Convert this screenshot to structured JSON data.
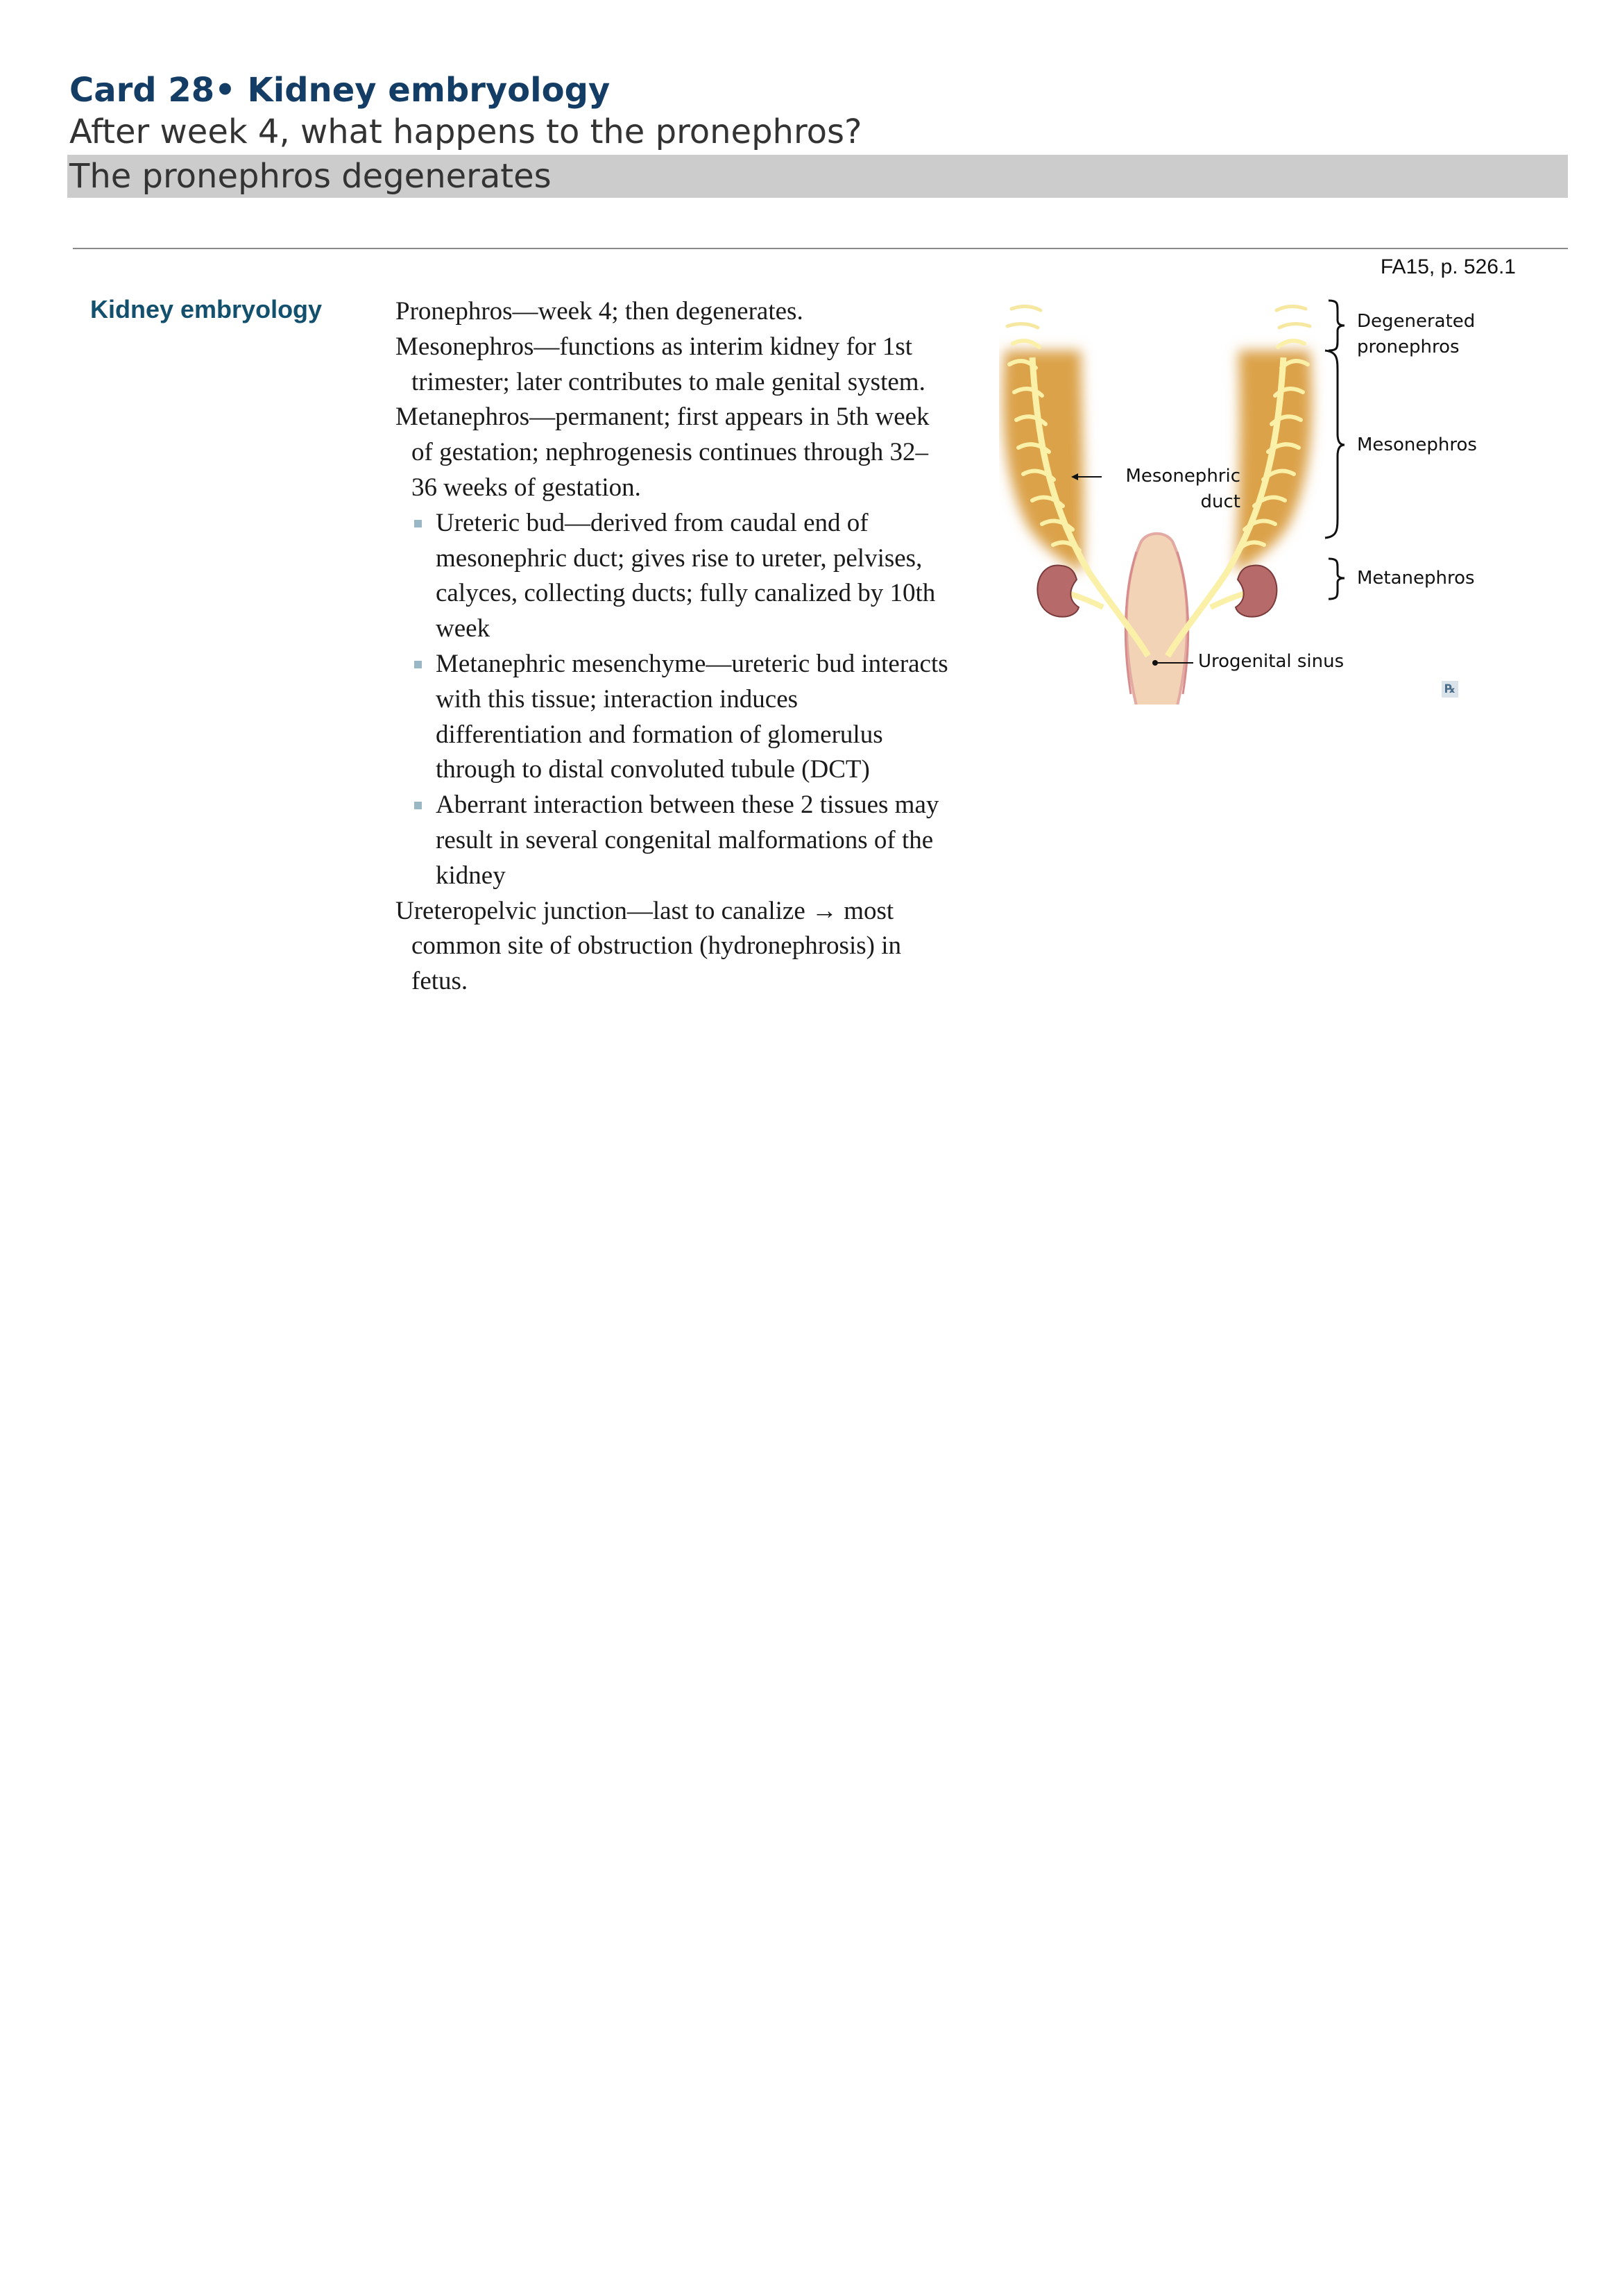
{
  "card": {
    "title": "Card 28• Kidney embryology",
    "question": "After week 4, what happens to the pronephros?",
    "answer": "The pronephros degenerates"
  },
  "source_ref": "FA15, p. 526.1",
  "section": {
    "heading": "Kidney embryology",
    "paragraphs": [
      "Pronephros—week 4; then degenerates.",
      "Mesonephros—functions as interim kidney for 1st trimester; later contributes to male genital system.",
      "Metanephros—permanent; first appears in 5th week of gestation; nephrogenesis continues through 32–36 weeks of gestation."
    ],
    "bullets": [
      "Ureteric bud—derived from caudal end of mesonephric duct; gives rise to ureter, pelvises, calyces, collecting ducts; fully canalized by 10th week",
      "Metanephric mesenchyme—ureteric bud interacts with this tissue; interaction induces differentiation and formation of glomerulus through to distal convoluted tubule (DCT)",
      "Aberrant interaction between these 2 tissues may result in several congenital malformations of the kidney"
    ],
    "closing": "Ureteropelvic junction—last to canalize → most common site of obstruction (hydronephrosis) in fetus."
  },
  "figure": {
    "labels": {
      "degenerated_1": "Degenerated",
      "degenerated_2": "pronephros",
      "mesonephros": "Mesonephros",
      "metanephros": "Metanephros",
      "duct_1": "Mesonephric",
      "duct_2": "duct",
      "sinus": "Urogenital sinus"
    },
    "rx_icon": "rx-icon",
    "colors": {
      "mesonephros": "#dba24a",
      "duct": "#fbf0a8",
      "metanephros": "#b76a6a",
      "sinus": "#f2d3b6"
    }
  }
}
